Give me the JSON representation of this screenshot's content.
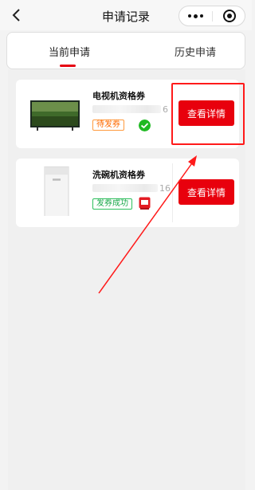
{
  "header": {
    "title": "申请记录"
  },
  "tabs": [
    {
      "label": "当前申请",
      "active": true
    },
    {
      "label": "历史申请",
      "active": false
    }
  ],
  "records": [
    {
      "name": "电视机资格券",
      "code_visible_suffix": "6",
      "status": "待发券",
      "payment_icon": "wechat-pay-icon",
      "button_label": "查看详情"
    },
    {
      "name": "洗碗机资格券",
      "code_visible_suffix": "16",
      "status": "发券成功",
      "payment_icon": "unionpay-icon",
      "button_label": "查看详情"
    }
  ],
  "colors": {
    "accent": "#e8000d",
    "pending": "#ff6a00",
    "success": "#1aa84a",
    "annotation": "#ff1a1a"
  }
}
